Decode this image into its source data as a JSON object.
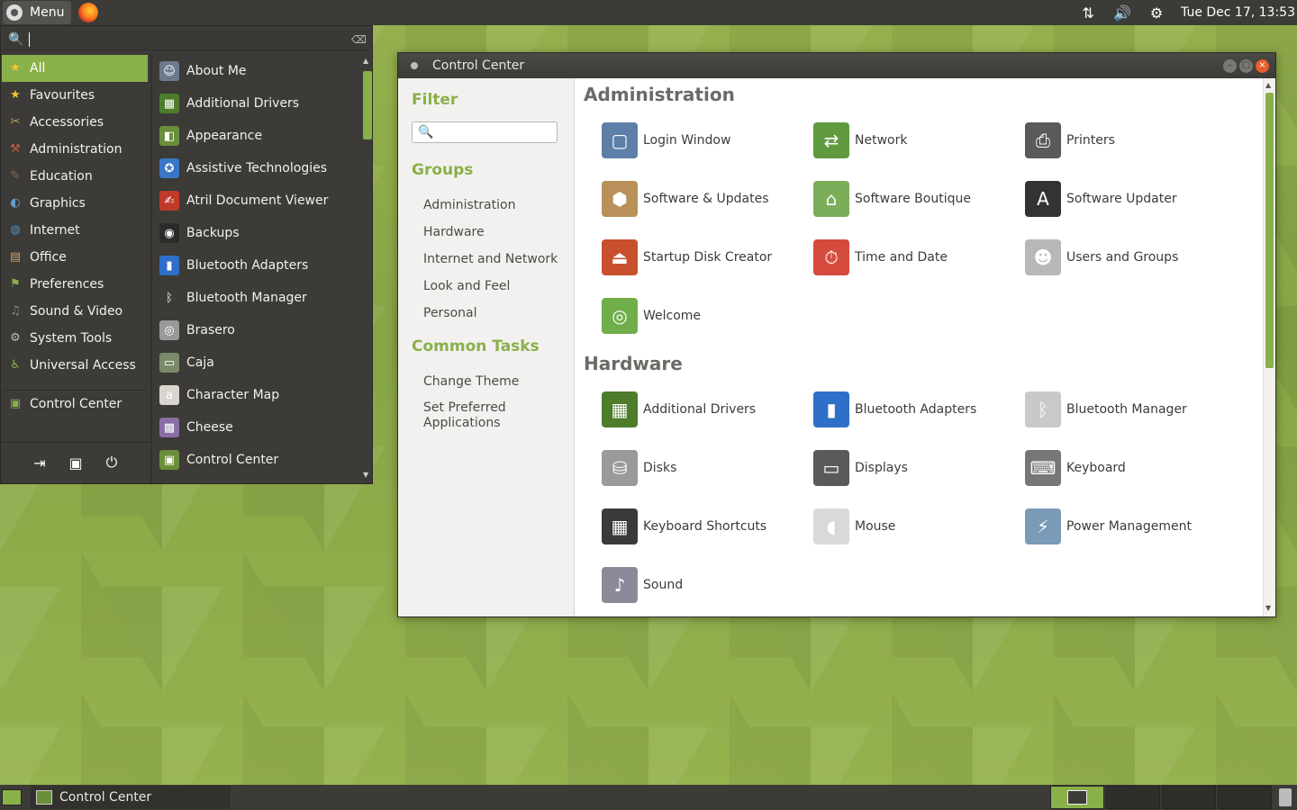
{
  "top_panel": {
    "menu_label": "Menu",
    "clock": "Tue Dec 17, 13:53"
  },
  "menu": {
    "categories": [
      {
        "label": "All",
        "icon": "star-icon"
      },
      {
        "label": "Favourites",
        "icon": "star-icon"
      },
      {
        "label": "Accessories",
        "icon": "accessories-icon"
      },
      {
        "label": "Administration",
        "icon": "administration-icon"
      },
      {
        "label": "Education",
        "icon": "education-icon"
      },
      {
        "label": "Graphics",
        "icon": "graphics-icon"
      },
      {
        "label": "Internet",
        "icon": "globe-icon"
      },
      {
        "label": "Office",
        "icon": "office-icon"
      },
      {
        "label": "Preferences",
        "icon": "preferences-icon"
      },
      {
        "label": "Sound & Video",
        "icon": "sound-video-icon"
      },
      {
        "label": "System Tools",
        "icon": "gear-icon"
      },
      {
        "label": "Universal Access",
        "icon": "universal-access-icon"
      },
      {
        "label": "Control Center",
        "icon": "control-center-icon"
      }
    ],
    "apps": [
      {
        "label": "About Me",
        "icon": "about-me-icon",
        "color": "#6c7a8c"
      },
      {
        "label": "Additional Drivers",
        "icon": "additional-drivers-icon",
        "color": "#4d7c2a"
      },
      {
        "label": "Appearance",
        "icon": "appearance-icon",
        "color": "#6b8e3b"
      },
      {
        "label": "Assistive Technologies",
        "icon": "assistive-icon",
        "color": "#3a76c4"
      },
      {
        "label": "Atril Document Viewer",
        "icon": "atril-icon",
        "color": "#c0392b"
      },
      {
        "label": "Backups",
        "icon": "backups-icon",
        "color": "#2b2b2b"
      },
      {
        "label": "Bluetooth Adapters",
        "icon": "bluetooth-adapter-icon",
        "color": "#2f6fc9"
      },
      {
        "label": "Bluetooth Manager",
        "icon": "bluetooth-icon",
        "color": "#3c3b37"
      },
      {
        "label": "Brasero",
        "icon": "brasero-icon",
        "color": "#9a9a9a"
      },
      {
        "label": "Caja",
        "icon": "caja-icon",
        "color": "#7a8a6a"
      },
      {
        "label": "Character Map",
        "icon": "character-map-icon",
        "color": "#d9d6cf"
      },
      {
        "label": "Cheese",
        "icon": "cheese-icon",
        "color": "#8a6fa6"
      },
      {
        "label": "Control Center",
        "icon": "control-center-icon",
        "color": "#6a8e3a"
      }
    ]
  },
  "window": {
    "title": "Control Center",
    "sidebar": {
      "filter_heading": "Filter",
      "groups_heading": "Groups",
      "groups": [
        "Administration",
        "Hardware",
        "Internet and Network",
        "Look and Feel",
        "Personal"
      ],
      "tasks_heading": "Common Tasks",
      "tasks": [
        "Change Theme",
        "Set Preferred Applications"
      ]
    },
    "sections": [
      {
        "title": "Administration",
        "items": [
          {
            "label": "Login Window",
            "icon": "login-window-icon",
            "color": "#5d7fa8"
          },
          {
            "label": "Network",
            "icon": "network-icon",
            "color": "#5f9a3f"
          },
          {
            "label": "Printers",
            "icon": "printer-icon",
            "color": "#5a5a5a"
          },
          {
            "label": "Software & Updates",
            "icon": "software-updates-icon",
            "color": "#b9905a"
          },
          {
            "label": "Software Boutique",
            "icon": "software-boutique-icon",
            "color": "#7cae5a"
          },
          {
            "label": "Software Updater",
            "icon": "software-updater-icon",
            "color": "#333333"
          },
          {
            "label": "Startup Disk Creator",
            "icon": "startup-disk-icon",
            "color": "#c9502e"
          },
          {
            "label": "Time and Date",
            "icon": "time-date-icon",
            "color": "#d44a3c"
          },
          {
            "label": "Users and Groups",
            "icon": "users-groups-icon",
            "color": "#b8b8b8"
          },
          {
            "label": "Welcome",
            "icon": "welcome-icon",
            "color": "#6fae4a"
          }
        ]
      },
      {
        "title": "Hardware",
        "items": [
          {
            "label": "Additional Drivers",
            "icon": "additional-drivers-icon",
            "color": "#4d7c2a"
          },
          {
            "label": "Bluetooth Adapters",
            "icon": "bluetooth-adapter-icon",
            "color": "#2f6fc9"
          },
          {
            "label": "Bluetooth Manager",
            "icon": "bluetooth-icon",
            "color": "#c9c9c9"
          },
          {
            "label": "Disks",
            "icon": "disks-icon",
            "color": "#9a9a9a"
          },
          {
            "label": "Displays",
            "icon": "displays-icon",
            "color": "#5a5a5a"
          },
          {
            "label": "Keyboard",
            "icon": "keyboard-icon",
            "color": "#777777"
          },
          {
            "label": "Keyboard Shortcuts",
            "icon": "keyboard-shortcuts-icon",
            "color": "#3a3a3a"
          },
          {
            "label": "Mouse",
            "icon": "mouse-icon",
            "color": "#d9d9d9"
          },
          {
            "label": "Power Management",
            "icon": "power-management-icon",
            "color": "#7a9ab8"
          },
          {
            "label": "Sound",
            "icon": "sound-icon",
            "color": "#8a8a9a"
          }
        ]
      }
    ]
  },
  "bottom_panel": {
    "task_label": "Control Center"
  },
  "colors": {
    "accent": "#8ab04a",
    "panel": "#3c3b37"
  }
}
